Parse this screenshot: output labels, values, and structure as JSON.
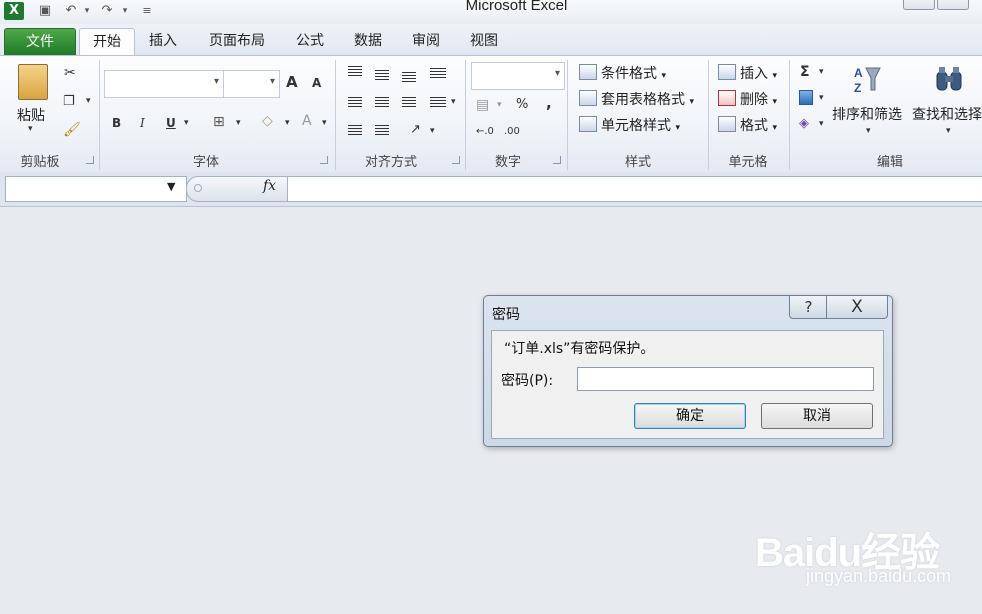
{
  "app": {
    "title": "Microsoft Excel"
  },
  "qat": {
    "icons": [
      "excel-logo-icon",
      "save-icon",
      "undo-icon",
      "redo-icon",
      "customize-qat-icon"
    ]
  },
  "tabs": {
    "file": "文件",
    "home": "开始",
    "insert": "插入",
    "page_layout": "页面布局",
    "formulas": "公式",
    "data": "数据",
    "review": "审阅",
    "view": "视图"
  },
  "ribbon": {
    "clipboard": {
      "paste": "粘贴",
      "label": "剪贴板"
    },
    "font": {
      "label": "字体",
      "bold": "B",
      "italic": "I",
      "underline": "U",
      "grow": "A",
      "shrink": "A",
      "font_color": "A"
    },
    "alignment": {
      "label": "对齐方式"
    },
    "number": {
      "label": "数字",
      "percent": "%",
      "comma": ",",
      "inc_decimal": "←.0",
      "dec_decimal": ".00"
    },
    "styles": {
      "label": "样式",
      "conditional": "条件格式",
      "table": "套用表格格式",
      "cell": "单元格样式"
    },
    "cells": {
      "label": "单元格",
      "insert": "插入",
      "delete": "删除",
      "format": "格式"
    },
    "editing": {
      "label": "编辑",
      "sigma": "Σ",
      "sort_filter": "排序和筛选",
      "find_select": "查找和选择"
    }
  },
  "formula_bar": {
    "fx": "fx",
    "name_box_value": "",
    "formula_value": ""
  },
  "dialog": {
    "title": "密码",
    "help": "?",
    "close": "X",
    "message": "“订单.xls”有密码保护。",
    "password_label": "密码(P):",
    "password_value": "",
    "ok": "确定",
    "cancel": "取消"
  },
  "watermark": {
    "logo": "Baidu经验",
    "sub": "jingyan.baidu.com"
  }
}
